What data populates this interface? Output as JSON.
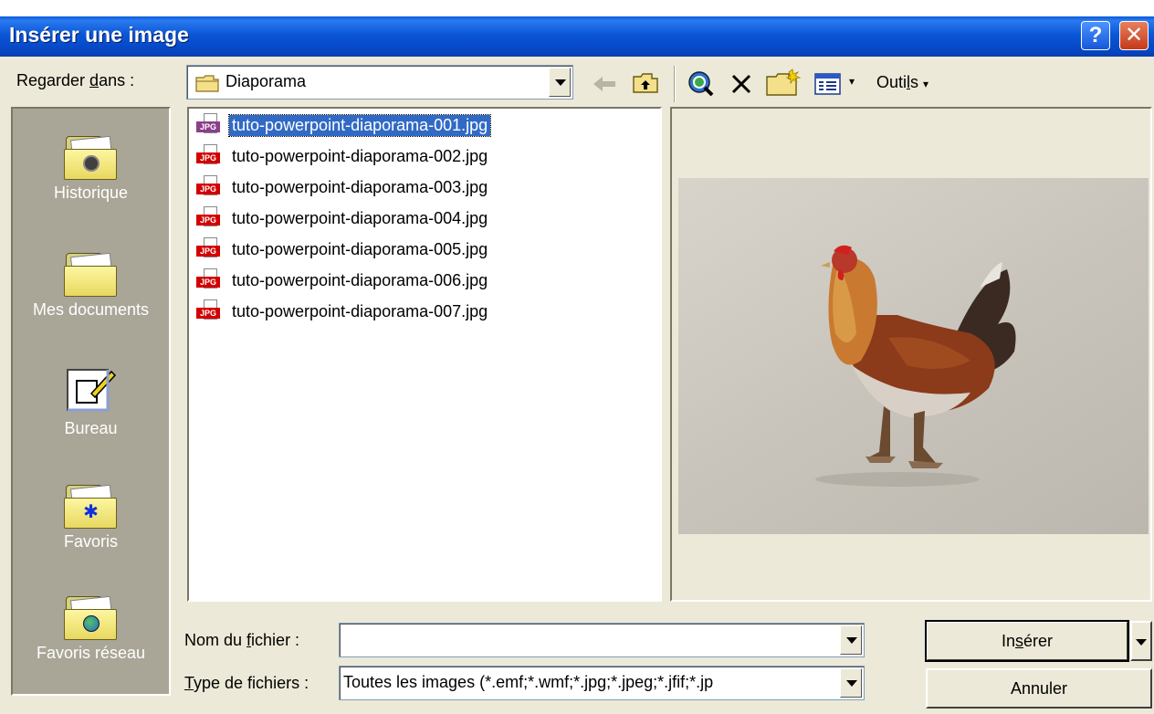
{
  "window": {
    "title": "Insérer une image",
    "help_glyph": "?",
    "close_glyph": "✕"
  },
  "lookin": {
    "label_pre": "Regarder ",
    "label_ul": "d",
    "label_post": "ans :",
    "value": "Diaporama"
  },
  "toolbar": {
    "tools_pre": "Outi",
    "tools_ul": "l",
    "tools_post": "s",
    "tools_arrow": "▾",
    "views_arrow": "▾"
  },
  "places": [
    {
      "label": "Historique"
    },
    {
      "label": "Mes documents"
    },
    {
      "label": "Bureau"
    },
    {
      "label": "Favoris"
    },
    {
      "label": "Favoris réseau"
    }
  ],
  "files": [
    {
      "name": "tuto-powerpoint-diaporama-001.jpg",
      "selected": true
    },
    {
      "name": "tuto-powerpoint-diaporama-002.jpg"
    },
    {
      "name": "tuto-powerpoint-diaporama-003.jpg"
    },
    {
      "name": "tuto-powerpoint-diaporama-004.jpg"
    },
    {
      "name": "tuto-powerpoint-diaporama-005.jpg"
    },
    {
      "name": "tuto-powerpoint-diaporama-006.jpg"
    },
    {
      "name": "tuto-powerpoint-diaporama-007.jpg"
    }
  ],
  "file_icon_tag": "JPG",
  "filename": {
    "label_pre": "Nom du ",
    "label_ul": "f",
    "label_post": "ichier :",
    "value": ""
  },
  "filetype": {
    "label_ul": "T",
    "label_post": "ype de fichiers :",
    "value": "Toutes les images (*.emf;*.wmf;*.jpg;*.jpeg;*.jfif;*.jp"
  },
  "buttons": {
    "insert_pre": "In",
    "insert_ul": "s",
    "insert_post": "érer",
    "cancel": "Annuler"
  },
  "colors": {
    "titlebar": "#0a56d6",
    "selection": "#316ac5",
    "places_bg": "#a9a597"
  }
}
